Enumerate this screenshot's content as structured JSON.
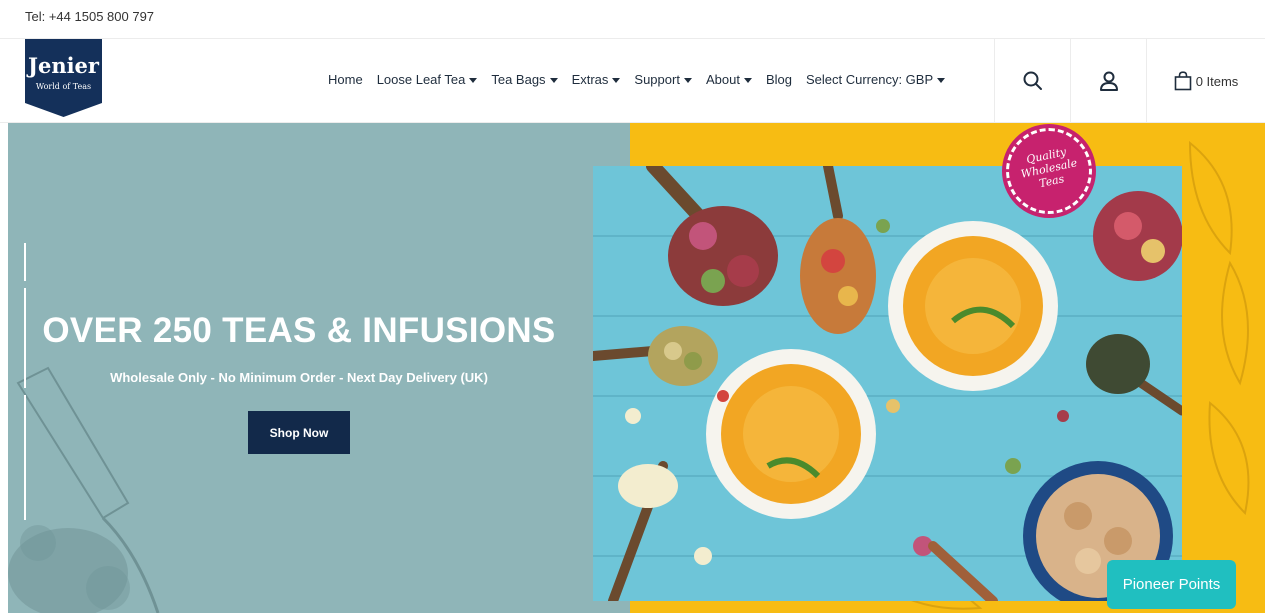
{
  "topbar": {
    "phone": "Tel: +44 1505 800 797"
  },
  "logo": {
    "name": "Jenier",
    "tagline": "World of Teas"
  },
  "nav": {
    "items": [
      {
        "label": "Home",
        "has_dropdown": false
      },
      {
        "label": "Loose Leaf Tea",
        "has_dropdown": true
      },
      {
        "label": "Tea Bags",
        "has_dropdown": true
      },
      {
        "label": "Extras",
        "has_dropdown": true
      },
      {
        "label": "Support",
        "has_dropdown": true
      },
      {
        "label": "About",
        "has_dropdown": true
      },
      {
        "label": "Blog",
        "has_dropdown": false
      },
      {
        "label": "Select Currency: GBP",
        "has_dropdown": true
      }
    ]
  },
  "header_icons": {
    "search": "search-icon",
    "account": "user-icon",
    "cart": "shopping-bag-icon"
  },
  "cart": {
    "label": "0 Items"
  },
  "hero": {
    "title": "OVER 250 TEAS & INFUSIONS",
    "subtitle": "Wholesale Only - No Minimum Order - Next Day Delivery (UK)",
    "cta_label": "Shop Now",
    "badge_text": "Quality Wholesale Teas"
  },
  "pioneer": {
    "label": "Pioneer Points"
  },
  "colors": {
    "hero_left_bg": "#8fb5b8",
    "hero_right_bg": "#f7bc13",
    "button_bg": "#12294a",
    "logo_bg": "#14305a",
    "badge_bg": "#c7226e",
    "pioneer_bg": "#20bfc0",
    "photo_bg": "#6ec5d8"
  }
}
